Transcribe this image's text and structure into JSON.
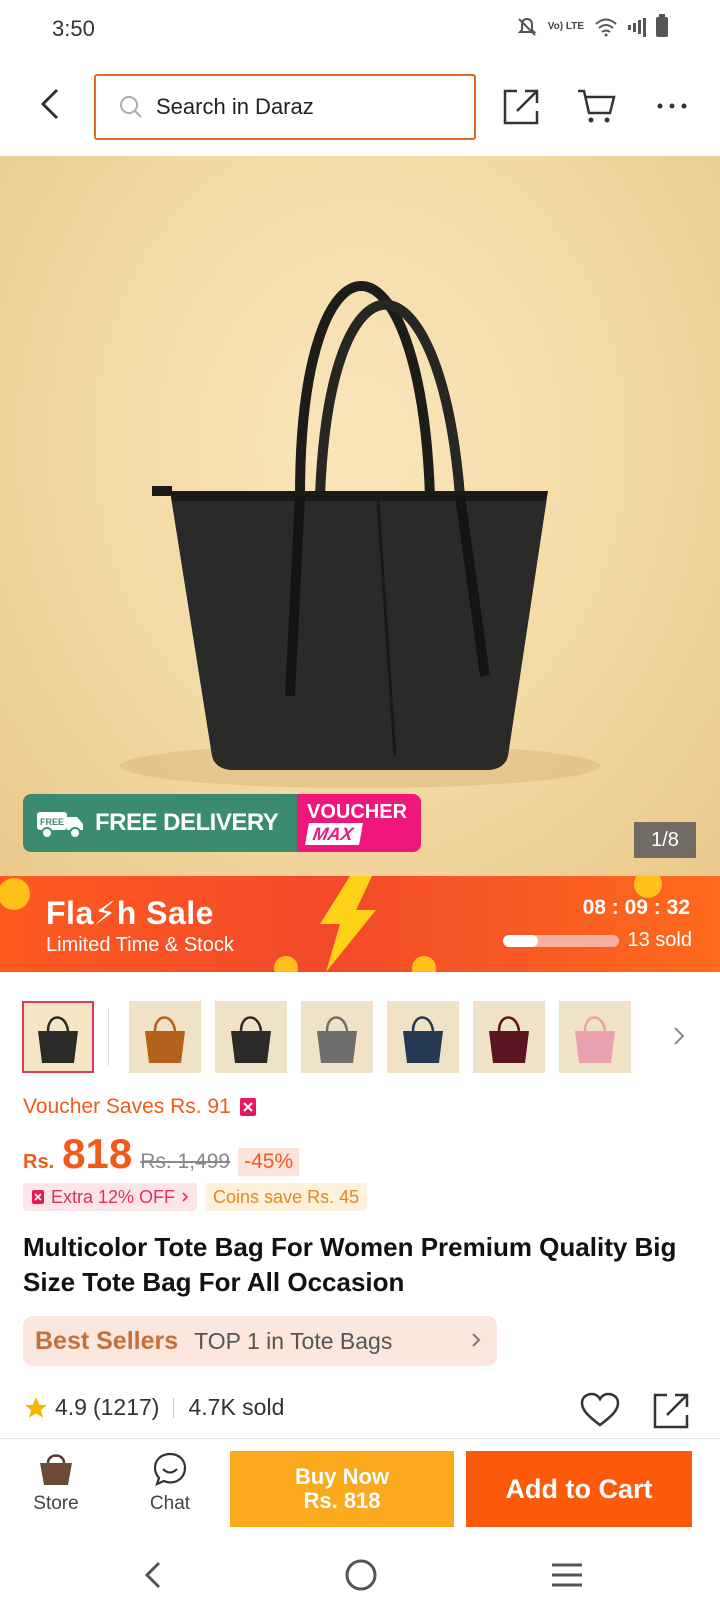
{
  "status": {
    "time": "3:50",
    "volte": "Vo) LTE"
  },
  "header": {
    "search_placeholder": "Search in Daraz"
  },
  "gallery": {
    "promo_free_label": "FREE DELIVERY",
    "promo_free_badge": "FREE",
    "promo_voucher_line1": "VOUCHER",
    "promo_voucher_line2": "MAX",
    "page_indicator": "1/8"
  },
  "flash_sale": {
    "title": "Fla⚡h  Sale",
    "subtitle": "Limited Time & Stock",
    "timer": "08 : 09 : 32",
    "sold": "13 sold",
    "progress_fraction": 0.3
  },
  "thumbnails": [
    {
      "color": "#2a2a28",
      "selected": true
    },
    {
      "color": "#b5601c",
      "selected": false
    },
    {
      "color": "#2b2a28",
      "selected": false
    },
    {
      "color": "#6e6e6c",
      "selected": false
    },
    {
      "color": "#273a55",
      "selected": false
    },
    {
      "color": "#5a1520",
      "selected": false
    },
    {
      "color": "#e9a1b0",
      "selected": false
    }
  ],
  "pricing": {
    "voucher_saves": "Voucher Saves Rs. 91",
    "currency": "Rs.",
    "price": "818",
    "old_price": "Rs. 1,499",
    "discount": "-45%",
    "extra_off": "Extra 12% OFF",
    "coins_save": "Coins save Rs. 45"
  },
  "product": {
    "title": "Multicolor Tote Bag For Women Premium Quality Big Size Tote Bag For All Occasion"
  },
  "best_sellers": {
    "label": "Best Sellers",
    "rank": "TOP 1 in Tote Bags"
  },
  "rating": {
    "score": "4.9",
    "count": "(1217)",
    "sold": "4.7K sold"
  },
  "bottom_bar": {
    "store_label": "Store",
    "chat_label": "Chat",
    "buy_now_line1": "Buy Now",
    "buy_now_line2": "Rs. 818",
    "add_to_cart": "Add to Cart"
  },
  "colors": {
    "accent": "#f25a1a",
    "buy_now": "#fbaa1d",
    "add_to_cart": "#fa5a0a",
    "free_delivery": "#3b8b6f",
    "voucher_max": "#f0177c"
  }
}
